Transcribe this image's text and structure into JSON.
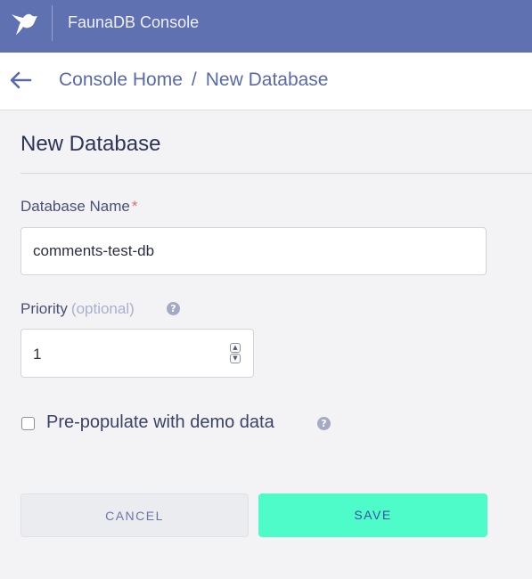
{
  "header": {
    "app_title": "FaunaDB Console",
    "logo_icon": "fauna-bird-icon",
    "bg_color": "#6071b2"
  },
  "breadcrumb": {
    "back_icon": "arrow-left-icon",
    "items": [
      "Console Home",
      "New Database"
    ],
    "separator": "/"
  },
  "form": {
    "title": "New Database",
    "name": {
      "label": "Database Name",
      "required_mark": "*",
      "value": "comments-test-db"
    },
    "priority": {
      "label": "Priority",
      "optional_label": "(optional)",
      "value": "1",
      "help_icon": "question-circle-icon"
    },
    "demo_data": {
      "label": "Pre-populate with demo data",
      "checked": false,
      "help_icon": "question-circle-icon"
    },
    "buttons": {
      "cancel": "CANCEL",
      "save": "SAVE"
    }
  },
  "colors": {
    "accent": "#4dfcc9",
    "link": "#5a6aa8",
    "required": "#e36b6b"
  }
}
